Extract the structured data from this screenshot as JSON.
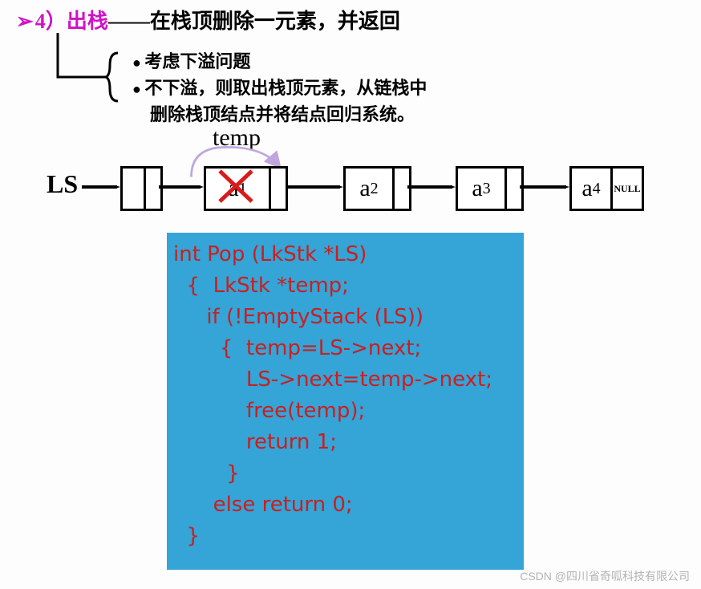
{
  "title": {
    "bullet": "➢",
    "num": "4）",
    "op": "出栈",
    "rest": "——在栈顶删除一元素，并返回"
  },
  "points": {
    "p1": "考虑下溢问题",
    "p2a": "不下溢，则取出栈顶元素，从链栈中",
    "p2b": "删除栈顶结点并将结点回归系统。"
  },
  "diagram": {
    "temp_label": "temp",
    "ls_label": "LS",
    "node1": "a",
    "node1_sub": "1",
    "node2": "a",
    "node2_sub": "2",
    "node3": "a",
    "node3_sub": "3",
    "node4": "a",
    "node4_sub": "4",
    "null_label": "NULL"
  },
  "code": {
    "text": "int Pop (LkStk *LS)\n  {  LkStk *temp;\n     if (!EmptyStack (LS))\n       {  temp=LS->next;\n           LS->next=temp->next;\n           free(temp);\n           return 1;\n        }\n      else return 0;\n  }"
  },
  "watermark": "CSDN @四川省奇呱科技有限公司"
}
